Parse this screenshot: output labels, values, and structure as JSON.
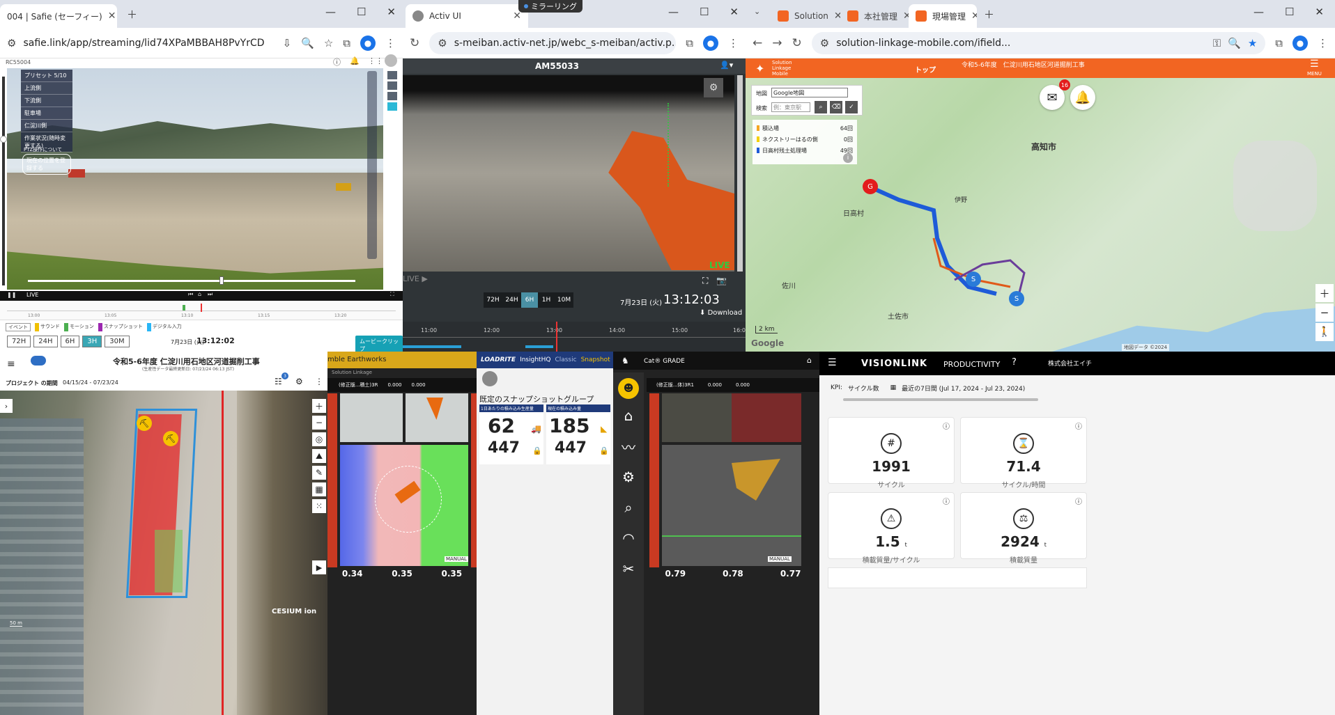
{
  "mirroring": "ミラーリング",
  "safie": {
    "tab_title": "004 | Safie (セーフィー)",
    "url": "safie.link/app/streaming/lid74XPaMBBAH8PvYrCD",
    "camera_name": "RC55004",
    "presets_title": "プリセット 5/10",
    "presets": [
      "上流側",
      "下流側",
      "駐車場",
      "仁淀川側",
      "作業状況(随時変更する)"
    ],
    "register_button": "現在の位置を登録する",
    "ptz_help": "PTZ操作について",
    "live_label": "LIVE",
    "timeline_ticks": [
      "13:00",
      "13:05",
      "13:10",
      "13:15",
      "13:20"
    ],
    "legend": [
      "イベント",
      "サウンド",
      "モーション",
      "スナップショット",
      "デジタル入力"
    ],
    "time_buttons": [
      "72H",
      "24H",
      "6H",
      "3H",
      "30M"
    ],
    "active_time": "3H",
    "date": "7月23日 (火)",
    "time": "13:12:02",
    "clip_button": "ムービークリップ"
  },
  "activ": {
    "tab_title": "Activ UI",
    "url": "s-meiban.activ-net.jp/webc_s-meiban/activ.p...",
    "machine_id": "AM55033",
    "live_label": "LIVE",
    "time_buttons": [
      "72H",
      "24H",
      "6H",
      "1H",
      "10M"
    ],
    "active_time": "6H",
    "date": "7月23日 (火)",
    "time": "13:12:03",
    "download_label": "Download",
    "timeline_ticks": [
      "11:00",
      "12:00",
      "13:00",
      "14:00",
      "15:00",
      "16:00"
    ]
  },
  "linkage": {
    "tabs": [
      "Solution",
      "本社管理",
      "現場管理"
    ],
    "url": "solution-linkage-mobile.com/ifield...",
    "logo_text": "Solution Linkage Mobile",
    "nav_top": "トップ",
    "project": "令和5-6年度　仁淀川用石地区河道掘削工事",
    "menu_label": "MENU",
    "map_label": "地図",
    "map_select": "Google地図",
    "search_label": "検索",
    "search_placeholder": "例：東京駅",
    "mail_badge": "16",
    "legend": [
      {
        "name": "積込場",
        "count": "64回",
        "color": "#f5a623"
      },
      {
        "name": "ネクストリーはるの側",
        "count": "0回",
        "color": "#f5d000"
      },
      {
        "name": "日高村残土処理場",
        "count": "49回",
        "color": "#1e5bd8"
      }
    ],
    "place_labels": [
      "高知市",
      "日高村",
      "佐川",
      "土佐市",
      "伊野"
    ],
    "scale": "2 km",
    "attribution": "地図データ ©2024",
    "google": "Google"
  },
  "cesium": {
    "title": "令和5-6年度 仁淀川用石地区河道掘削工事",
    "subtitle": "(生産性データ最終更新日: 07/23/24 06:13 JST)",
    "period_label": "プロジェクト の期間",
    "period": "04/15/24 - 07/23/24",
    "badge": "3",
    "cesium_logo": "CESIUM ion",
    "scale": "50 m"
  },
  "trimble": {
    "title": "mble Earthworks",
    "sub": "Solution Linkage",
    "design_label": "(修正版...積土)3R",
    "value1": "0.000",
    "value2": "0.000",
    "mode": "MANUAL",
    "bottom": [
      "0.34",
      "0.35",
      "0.35"
    ]
  },
  "loadrite": {
    "brand": "LOADRITE",
    "product": "InsightHQ",
    "tabs": [
      "Classic",
      "Snapshot"
    ],
    "group_title": "既定のスナップショットグループ",
    "card1_label": "1日あたりの積み込み生産量",
    "card2_label": "現在の積み込み量",
    "card1_top": "62",
    "card1_bottom": "447",
    "card2_top": "185",
    "card2_bottom": "447"
  },
  "catgrade": {
    "title": "Cat® GRADE",
    "design_label": "(修正版...体)3R1",
    "value1": "0.000",
    "value2": "0.000",
    "mode": "MANUAL",
    "bottom": [
      "0.79",
      "0.78",
      "0.77"
    ]
  },
  "visionlink": {
    "brand": "VISIONLINK",
    "product": "PRODUCTIVITY",
    "company": "株式会社エイチ",
    "kpi_label": "KPI:",
    "kpi_select": "サイクル数",
    "date_range": "最近の7日間 (Jul 17, 2024 - Jul 23, 2024)",
    "cards": [
      {
        "value": "1991",
        "unit": "",
        "label": "サイクル",
        "icon": "#"
      },
      {
        "value": "71.4",
        "unit": "",
        "label": "サイクル/時間",
        "icon": "⌛"
      },
      {
        "value": "1.5",
        "unit": "t",
        "label": "積載質量/サイクル",
        "icon": "⚠"
      },
      {
        "value": "2924",
        "unit": "t",
        "label": "積載質量",
        "icon": "⚖"
      }
    ]
  }
}
